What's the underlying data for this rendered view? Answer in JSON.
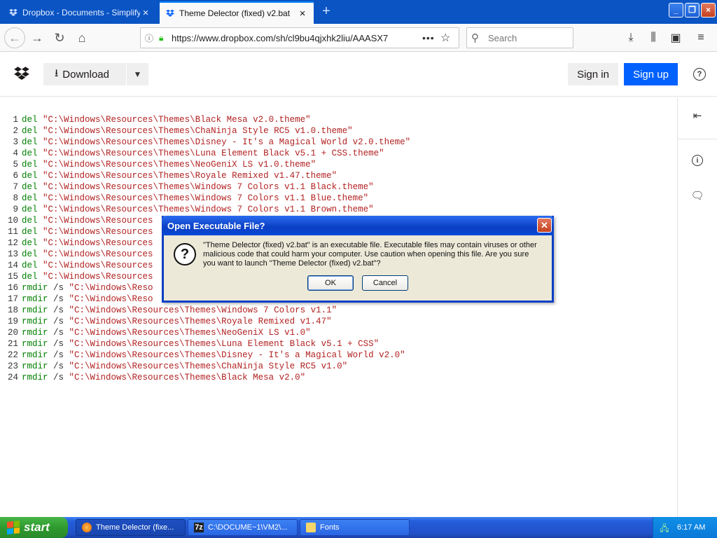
{
  "browser": {
    "tabs": [
      {
        "title": "Dropbox - Documents - Simplify y",
        "active": false
      },
      {
        "title": "Theme Delector (fixed) v2.bat",
        "active": true
      }
    ],
    "url": "https://www.dropbox.com/sh/cl9bu4qjxhk2liu/AAASX7",
    "search_placeholder": "Search"
  },
  "dropbox": {
    "download_label": "Download",
    "signin_label": "Sign in",
    "signup_label": "Sign up",
    "help_label": "?"
  },
  "code": [
    {
      "num": "1",
      "cmd": "del",
      "args": "",
      "path": "\"C:\\Windows\\Resources\\Themes\\Black Mesa v2.0.theme\""
    },
    {
      "num": "2",
      "cmd": "del",
      "args": "",
      "path": "\"C:\\Windows\\Resources\\Themes\\ChaNinja Style RC5 v1.0.theme\""
    },
    {
      "num": "3",
      "cmd": "del",
      "args": "",
      "path": "\"C:\\Windows\\Resources\\Themes\\Disney - It's a Magical World v2.0.theme\""
    },
    {
      "num": "4",
      "cmd": "del",
      "args": "",
      "path": "\"C:\\Windows\\Resources\\Themes\\Luna Element Black v5.1 + CSS.theme\""
    },
    {
      "num": "5",
      "cmd": "del",
      "args": "",
      "path": "\"C:\\Windows\\Resources\\Themes\\NeoGeniX LS v1.0.theme\""
    },
    {
      "num": "6",
      "cmd": "del",
      "args": "",
      "path": "\"C:\\Windows\\Resources\\Themes\\Royale Remixed v1.47.theme\""
    },
    {
      "num": "7",
      "cmd": "del",
      "args": "",
      "path": "\"C:\\Windows\\Resources\\Themes\\Windows 7 Colors v1.1 Black.theme\""
    },
    {
      "num": "8",
      "cmd": "del",
      "args": "",
      "path": "\"C:\\Windows\\Resources\\Themes\\Windows 7 Colors v1.1 Blue.theme\""
    },
    {
      "num": "9",
      "cmd": "del",
      "args": "",
      "path": "\"C:\\Windows\\Resources\\Themes\\Windows 7 Colors v1.1 Brown.theme\""
    },
    {
      "num": "10",
      "cmd": "del",
      "args": "",
      "path": "\"C:\\Windows\\Resources"
    },
    {
      "num": "11",
      "cmd": "del",
      "args": "",
      "path": "\"C:\\Windows\\Resources"
    },
    {
      "num": "12",
      "cmd": "del",
      "args": "",
      "path": "\"C:\\Windows\\Resources"
    },
    {
      "num": "13",
      "cmd": "del",
      "args": "",
      "path": "\"C:\\Windows\\Resources"
    },
    {
      "num": "14",
      "cmd": "del",
      "args": "",
      "path": "\"C:\\Windows\\Resources"
    },
    {
      "num": "15",
      "cmd": "del",
      "args": "",
      "path": "\"C:\\Windows\\Resources"
    },
    {
      "num": "16",
      "cmd": "rmdir",
      "args": " /s ",
      "path": "\"C:\\Windows\\Reso"
    },
    {
      "num": "17",
      "cmd": "rmdir",
      "args": " /s ",
      "path": "\"C:\\Windows\\Reso"
    },
    {
      "num": "18",
      "cmd": "rmdir",
      "args": " /s ",
      "path": "\"C:\\Windows\\Resources\\Themes\\Windows 7 Colors v1.1\""
    },
    {
      "num": "19",
      "cmd": "rmdir",
      "args": " /s ",
      "path": "\"C:\\Windows\\Resources\\Themes\\Royale Remixed v1.47\""
    },
    {
      "num": "20",
      "cmd": "rmdir",
      "args": " /s ",
      "path": "\"C:\\Windows\\Resources\\Themes\\NeoGeniX LS v1.0\""
    },
    {
      "num": "21",
      "cmd": "rmdir",
      "args": " /s ",
      "path": "\"C:\\Windows\\Resources\\Themes\\Luna Element Black v5.1 + CSS\""
    },
    {
      "num": "22",
      "cmd": "rmdir",
      "args": " /s ",
      "path": "\"C:\\Windows\\Resources\\Themes\\Disney - It's a Magical World v2.0\""
    },
    {
      "num": "23",
      "cmd": "rmdir",
      "args": " /s ",
      "path": "\"C:\\Windows\\Resources\\Themes\\ChaNinja Style RC5 v1.0\""
    },
    {
      "num": "24",
      "cmd": "rmdir",
      "args": " /s ",
      "path": "\"C:\\Windows\\Resources\\Themes\\Black Mesa v2.0\""
    }
  ],
  "dialog": {
    "title": "Open Executable File?",
    "message": "\"Theme Delector (fixed) v2.bat\" is an executable file. Executable files may contain viruses or other malicious code that could harm your computer. Use caution when opening this file. Are you sure you want to launch \"Theme Delector (fixed) v2.bat\"?",
    "ok_label": "OK",
    "cancel_label": "Cancel"
  },
  "taskbar": {
    "start_label": "start",
    "tasks": [
      {
        "label": "Theme Delector (fixe...",
        "icon": "firefox-icon"
      },
      {
        "label": "C:\\DOCUME~1\\VM2\\...",
        "icon": "7zip-icon"
      },
      {
        "label": "Fonts",
        "icon": "folder-icon"
      }
    ],
    "clock": "6:17 AM"
  },
  "colors": {
    "keyword": "#008000",
    "string": "#b22222",
    "dropbox_blue": "#0061fe",
    "xp_blue": "#245edb"
  }
}
